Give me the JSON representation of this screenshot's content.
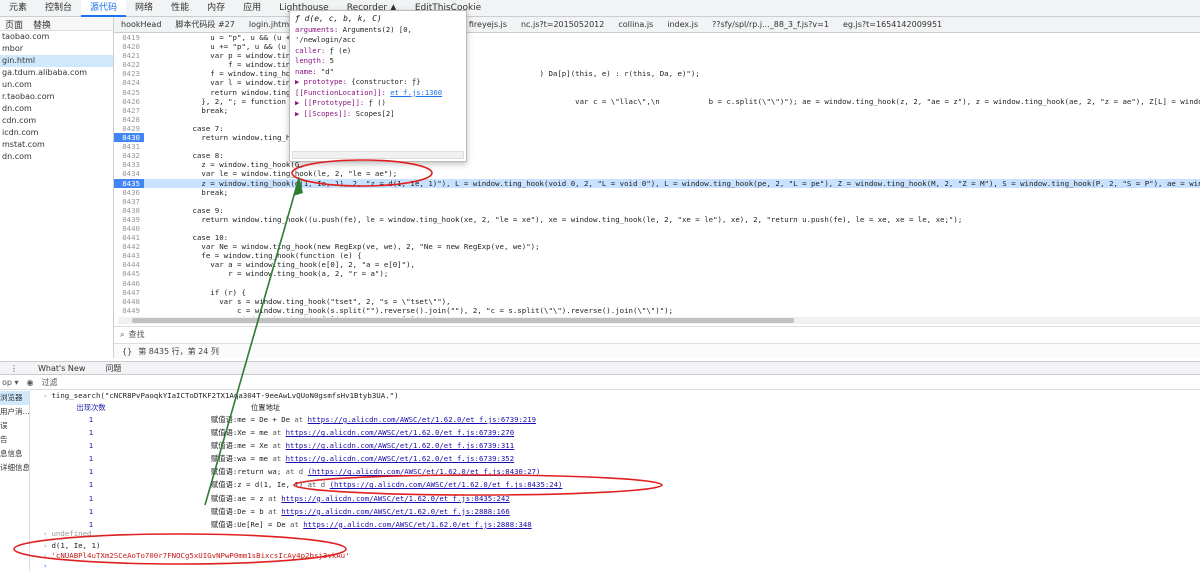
{
  "top_tabs": [
    "元素",
    "控制台",
    "源代码",
    "网络",
    "性能",
    "内存",
    "应用",
    "Lighthouse",
    "Recorder ▲",
    "EditThisCookie"
  ],
  "left_nav": {
    "tabs": [
      "页面",
      "替换"
    ],
    "items": [
      "taobao.com",
      "mbor",
      "gin.html",
      "ga.tdum.alibaba.com",
      "un.com",
      "r.taobao.com",
      "dn.com",
      "cdn.com",
      "icdn.com",
      "mstat.com",
      "dn.com"
    ]
  },
  "file_tabs": [
    "hookHead",
    "脚本代码段 #27",
    "login.jhtml",
    "baxiaCommon.js",
    "et_f.js",
    "um.js",
    "fireyejs.js",
    "nc.js?t=2015052012",
    "collina.js",
    "index.js",
    "??sfy/spl/rp.j..._88_3_f.js?v=1",
    "eg.js?t=1654142009951"
  ],
  "editor": {
    "lines": [
      {
        "n": "8419",
        "c": "              u = \"p\", u && (u += \""
      },
      {
        "n": "8420",
        "c": "              u += \"p\", u && (u += \""
      },
      {
        "n": "8421",
        "c": "              var p = window.ting_hook("
      },
      {
        "n": "8422",
        "c": "                  f = window.ting_hook("
      },
      {
        "n": "8423",
        "c": "              f = window.ting_hook(f                                                    ) Da[p](this, e) : r(this, Da, e)\");"
      },
      {
        "n": "8424",
        "c": "              var l = window.ting_hook("
      },
      {
        "n": "8425",
        "c": "              return window.ting_hook("
      },
      {
        "n": "8426",
        "c": "            }, 2, \"; = function () {                                                            var c = \\\"llac\\\",\\n           b = c.split(\\\"\\\")\"); ae = window.ting_hook(z, 2, \"ae = z\"), z = window.ting_hook(ae, 2, \"z = ae\"), Z[L] = window.ting_hook(z, 2, \"Z[L] = z\"), pe = wind"
      },
      {
        "n": "8427",
        "c": "            break;"
      },
      {
        "n": "8428",
        "c": ""
      },
      {
        "n": "8429",
        "c": "          case 7:"
      },
      {
        "n": "8430",
        "c": "            return window.ting_hook(                                     ",
        "bp": true
      },
      {
        "n": "8431",
        "c": ""
      },
      {
        "n": "8432",
        "c": "          case 8:"
      },
      {
        "n": "8433",
        "c": "            z = window.ting_hook(G,"
      },
      {
        "n": "8434",
        "c": "            var le = window.ting_hook(le, 2, \"le = ae\");"
      },
      {
        "n": "8435",
        "c": "            z = window.ting_hook(d(1, Ie, 1), 2, \"z = d(1, Ie, 1)\"), L = window.ting_hook(void 0, 2, \"L = void 0\"), L = window.ting_hook(pe, 2, \"L = pe\"), Z = window.ting_hook(M, 2, \"Z = M\"), S = window.ting_hook(P, 2, \"S = P\"), ae = window.ting_hook(p",
        "bp": true,
        "hl": true
      },
      {
        "n": "8436",
        "c": "            break;"
      },
      {
        "n": "8437",
        "c": ""
      },
      {
        "n": "8438",
        "c": "          case 9:"
      },
      {
        "n": "8439",
        "c": "            return window.ting_hook((u.push(fe), le = window.ting_hook(xe, 2, \"le = xe\"), xe = window.ting_hook(le, 2, \"xe = le\"), xe), 2, \"return u.push(fe), le = xe, xe = le, xe;\");"
      },
      {
        "n": "8440",
        "c": ""
      },
      {
        "n": "8441",
        "c": "          case 10:"
      },
      {
        "n": "8442",
        "c": "            var Ne = window.ting_hook(new RegExp(ve, we), 2, \"Ne = new RegExp(ve, we)\");"
      },
      {
        "n": "8443",
        "c": "            fe = window.ting_hook(function (e) {"
      },
      {
        "n": "8444",
        "c": "              var a = window.ting_hook(e[0], 2, \"a = e[0]\"),"
      },
      {
        "n": "8445",
        "c": "                  r = window.ting_hook(a, 2, \"r = a\");"
      },
      {
        "n": "8446",
        "c": ""
      },
      {
        "n": "8447",
        "c": "              if (r) {"
      },
      {
        "n": "8448",
        "c": "                var s = window.ting_hook(\"tset\", 2, \"s = \\\"tset\\\"\"),"
      },
      {
        "n": "8449",
        "c": "                    c = window.ting_hook(s.split(\"\").reverse().join(\"\"), 2, \"c = s.split(\\\"\\\").reverse().join(\\\"\\\")\");"
      },
      {
        "n": "8450",
        "c": "                r = window.ting_hook(Ne[c](e), 2, \"r = Ne[c](e)\");"
      },
      {
        "n": "8451",
        "c": "              }"
      }
    ]
  },
  "popover": {
    "title": "ƒ d(e, c, b, k, C)",
    "rows": [
      {
        "k": "arguments:",
        "v": "Arguments(2) [0, '/newlogin/acc"
      },
      {
        "k": "caller:",
        "v": "ƒ (e)"
      },
      {
        "k": "length:",
        "v": "5"
      },
      {
        "k": "name:",
        "v": "\"d\""
      },
      {
        "k": "▶ prototype:",
        "v": "{constructor: ƒ}"
      },
      {
        "k": "[[FunctionLocation]]:",
        "v": "et_f.js:1360",
        "link": true
      },
      {
        "k": "▶ [[Prototype]]:",
        "v": "ƒ ()"
      },
      {
        "k": "▶ [[Scopes]]:",
        "v": "Scopes[2]"
      }
    ]
  },
  "search_bar": {
    "placeholder": "查找"
  },
  "status_bar": {
    "text": "第 8435 行，第 24 列"
  },
  "drawer": {
    "tabs": [
      "What's New",
      "问题"
    ],
    "filter_placeholder": "过滤"
  },
  "console_side": [
    "浏览器",
    "用户消...",
    "误",
    "告",
    "息信息",
    "详细信息"
  ],
  "console": {
    "command": "ting_search(\"cNCR8PvPaoqkYIaICToDTKF2TX1Aqa304T-9eeAwLvQUoN0gsmfsHv1Btyb3UA.\")",
    "headers": {
      "count": "出现次数",
      "location": "位置地址"
    },
    "rows": [
      {
        "count": "1",
        "label": "赋值语:me = De + De",
        "at": "at",
        "url": "https://g.alicdn.com/AWSC/et/1.62.0/et_f.js:6739:219"
      },
      {
        "count": "1",
        "label": "赋值语:Xe = me",
        "at": "at",
        "url": "https://g.alicdn.com/AWSC/et/1.62.0/et_f.js:6739:270"
      },
      {
        "count": "1",
        "label": "赋值语:me = Xe",
        "at": "at",
        "url": "https://g.alicdn.com/AWSC/et/1.62.0/et_f.js:6739:311"
      },
      {
        "count": "1",
        "label": "赋值语:wa = me",
        "at": "at",
        "url": "https://g.alicdn.com/AWSC/et/1.62.0/et_f.js:6739:352"
      },
      {
        "count": "1",
        "label": "赋值语:return wa;",
        "at": "at d",
        "url": "(https://g.alicdn.com/AWSC/et/1.62.0/et_f.js:8430:27)"
      },
      {
        "count": "1",
        "label": "赋值语:z = d(1, Ie, 1)",
        "at": "at d",
        "url": "(https://g.alicdn.com/AWSC/et/1.62.0/et_f.js:8435:24)"
      },
      {
        "count": "1",
        "label": "赋值语:ae = z",
        "at": "at",
        "url": "https://g.alicdn.com/AWSC/et/1.62.0/et_f.js:8435:242"
      },
      {
        "count": "1",
        "label": "赋值语:De = b",
        "at": "at",
        "url": "https://g.alicdn.com/AWSC/et/1.62.0/et_f.js:2888:166"
      },
      {
        "count": "1",
        "label": "赋值语:Ue[Re] = De",
        "at": "at",
        "url": "https://g.alicdn.com/AWSC/et/1.62.0/et_f.js:2888:348"
      }
    ],
    "undefined_line": "undefined",
    "eval_input": "d(1, Ie, 1)",
    "eval_result": "'cNUABPl4uTXm2SCeAoTo700r7FNOCg5xUIGvNPwP0mm1sBixcsIcAy4p2bsj3vkAu'"
  },
  "annotation_colors": {
    "ellipse": "#e02020",
    "arrow": "#2e7d32"
  }
}
